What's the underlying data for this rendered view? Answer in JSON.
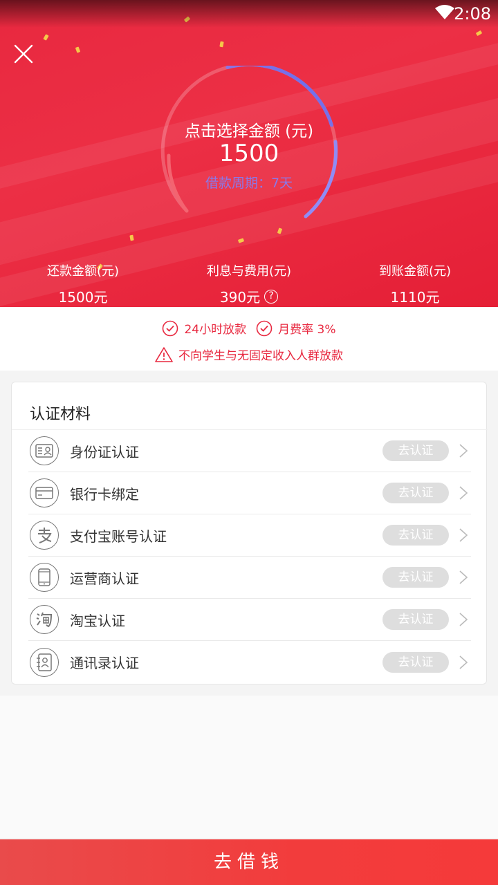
{
  "status_bar": {
    "time": "2:08"
  },
  "dial": {
    "title": "点击选择金额 (元)",
    "amount": "1500",
    "period": "借款周期：7天"
  },
  "stats": [
    {
      "label": "还款金额(元)",
      "value": "1500元"
    },
    {
      "label": "利息与费用(元)",
      "value": "390元",
      "help_icon": "?"
    },
    {
      "label": "到账金额(元)",
      "value": "1110元"
    }
  ],
  "notice": {
    "badge_1": "24小时放款",
    "badge_2": "月费率 3%",
    "warning": "不向学生与无固定收入人群放款",
    "color": "#e8283f"
  },
  "auth": {
    "title": "认证材料",
    "items": [
      {
        "label": "身份证认证",
        "button": "去认证",
        "icon": "id-card-icon"
      },
      {
        "label": "银行卡绑定",
        "button": "去认证",
        "icon": "bank-card-icon"
      },
      {
        "label": "支付宝账号认证",
        "button": "去认证",
        "icon": "alipay-icon"
      },
      {
        "label": "运营商认证",
        "button": "去认证",
        "icon": "phone-icon"
      },
      {
        "label": "淘宝认证",
        "button": "去认证",
        "icon": "taobao-icon"
      },
      {
        "label": "通讯录认证",
        "button": "去认证",
        "icon": "contacts-icon"
      }
    ]
  },
  "cta": {
    "label": "去借钱"
  },
  "colors": {
    "brand_red": "#e8283f",
    "dial_blue": "#6a6cf0",
    "period_purple": "#8b78e8"
  }
}
